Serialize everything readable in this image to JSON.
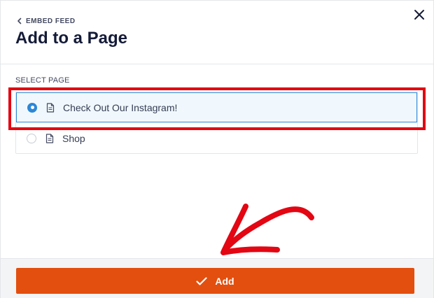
{
  "header": {
    "back_label": "EMBED FEED",
    "title": "Add to a Page"
  },
  "section": {
    "label": "SELECT PAGE"
  },
  "pages": [
    {
      "name": "Check Out Our Instagram!",
      "selected": true
    },
    {
      "name": "Shop",
      "selected": false
    }
  ],
  "footer": {
    "add_label": "Add"
  },
  "colors": {
    "accent_blue": "#2c87d6",
    "add_button": "#e34f0e",
    "annotation_red": "#e30613",
    "title": "#141b38"
  },
  "icons": {
    "back": "chevron-left-icon",
    "close": "close-icon",
    "page": "document-icon",
    "add": "checkmark-icon"
  }
}
